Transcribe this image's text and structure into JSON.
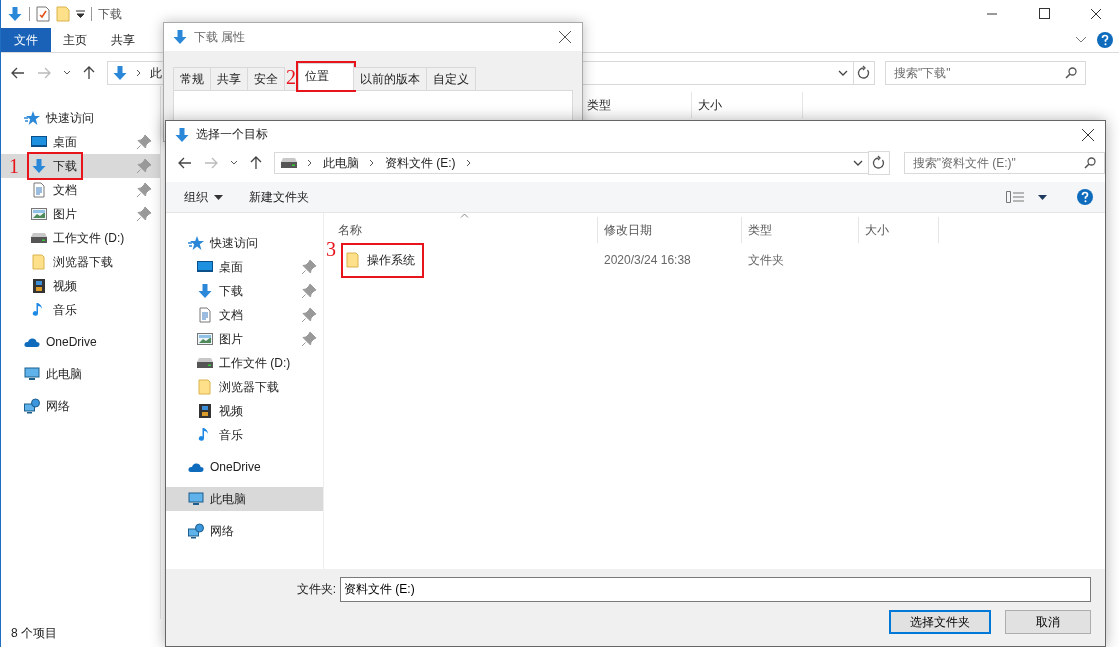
{
  "explorer": {
    "title": "下载",
    "ribbon_tabs": [
      {
        "label": "文件",
        "selected": true
      },
      {
        "label": "主页",
        "selected": false
      },
      {
        "label": "共享",
        "selected": false
      }
    ],
    "address": "此",
    "search": {
      "placeholder": "搜索\"下载\""
    },
    "columns": [
      "类型",
      "大小"
    ],
    "nav": [
      {
        "label": "快速访问",
        "selected": false,
        "children": [
          {
            "label": "桌面",
            "pinned": true,
            "selected": false
          },
          {
            "label": "下载",
            "pinned": true,
            "selected": true,
            "callout": "1"
          },
          {
            "label": "文档",
            "pinned": true,
            "selected": false
          },
          {
            "label": "图片",
            "pinned": true,
            "selected": false
          },
          {
            "label": "工作文件 (D:)",
            "pinned": false,
            "selected": false
          },
          {
            "label": "浏览器下载",
            "pinned": false,
            "selected": false
          },
          {
            "label": "视频",
            "pinned": false,
            "selected": false
          },
          {
            "label": "音乐",
            "pinned": false,
            "selected": false
          }
        ]
      },
      {
        "label": "OneDrive",
        "selected": false
      },
      {
        "label": "此电脑",
        "selected": false
      },
      {
        "label": "网络",
        "selected": false
      }
    ],
    "status_bar": "8 个项目"
  },
  "properties": {
    "title": "下载 属性",
    "tabs": [
      {
        "label": "常规",
        "selected": false
      },
      {
        "label": "共享",
        "selected": false
      },
      {
        "label": "安全",
        "selected": false
      },
      {
        "label": "位置",
        "selected": true,
        "callout": "2"
      },
      {
        "label": "以前的版本",
        "selected": false
      },
      {
        "label": "自定义",
        "selected": false
      }
    ]
  },
  "dialog": {
    "title": "选择一个目标",
    "breadcrumb": [
      "此电脑",
      "资料文件 (E:)"
    ],
    "search": {
      "placeholder": "搜索\"资料文件 (E:)\""
    },
    "toolbar": [
      "组织",
      "新建文件夹"
    ],
    "nav": [
      {
        "label": "快速访问",
        "selected": false,
        "children": [
          {
            "label": "桌面",
            "pinned": true,
            "selected": false
          },
          {
            "label": "下载",
            "pinned": true,
            "selected": false
          },
          {
            "label": "文档",
            "pinned": true,
            "selected": false
          },
          {
            "label": "图片",
            "pinned": true,
            "selected": false
          },
          {
            "label": "工作文件 (D:)",
            "pinned": false,
            "selected": false
          },
          {
            "label": "浏览器下载",
            "pinned": false,
            "selected": false
          },
          {
            "label": "视频",
            "pinned": false,
            "selected": false
          },
          {
            "label": "音乐",
            "pinned": false,
            "selected": false
          }
        ]
      },
      {
        "label": "OneDrive",
        "selected": false
      },
      {
        "label": "此电脑",
        "selected": true
      },
      {
        "label": "网络",
        "selected": false
      }
    ],
    "columns": [
      "名称",
      "修改日期",
      "类型",
      "大小"
    ],
    "rows": [
      {
        "name": "操作系统",
        "date": "2020/3/24 16:38",
        "type": "文件夹",
        "selected": false,
        "callout": "3"
      }
    ],
    "folder_label": "文件夹:",
    "folder_value": "资料文件 (E:)",
    "buttons": [
      {
        "label": "选择文件夹",
        "default": true
      },
      {
        "label": "取消",
        "default": false
      }
    ]
  }
}
